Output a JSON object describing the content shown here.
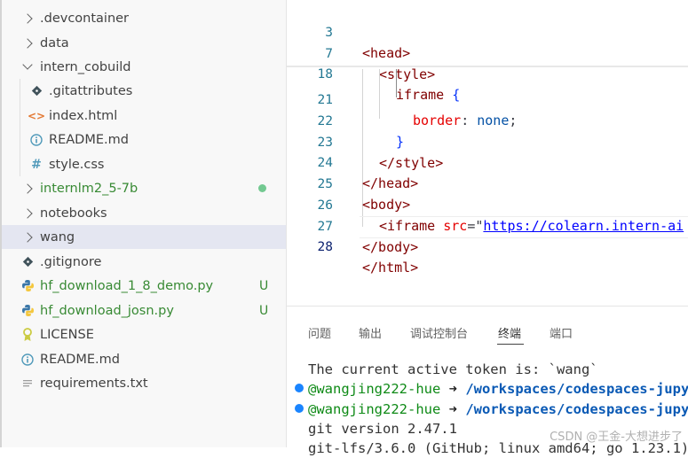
{
  "explorer": {
    "items": [
      {
        "label": ".devcontainer",
        "type": "folder-collapsed"
      },
      {
        "label": "data",
        "type": "folder-collapsed"
      },
      {
        "label": "intern_cobuild",
        "type": "folder-expanded"
      },
      {
        "label": ".gitattributes",
        "type": "git-icon"
      },
      {
        "label": "index.html",
        "type": "html-icon"
      },
      {
        "label": "README.md",
        "type": "info-icon"
      },
      {
        "label": "style.css",
        "type": "css-icon"
      },
      {
        "label": "internlm2_5-7b",
        "type": "folder-collapsed"
      },
      {
        "label": "notebooks",
        "type": "folder-collapsed"
      },
      {
        "label": "wang",
        "type": "folder-collapsed"
      },
      {
        "label": ".gitignore",
        "type": "git-icon"
      },
      {
        "label": "hf_download_1_8_demo.py",
        "type": "python-icon",
        "badge": "U"
      },
      {
        "label": "hf_download_josn.py",
        "type": "python-icon",
        "badge": "U"
      },
      {
        "label": "LICENSE",
        "type": "license-icon"
      },
      {
        "label": "README.md",
        "type": "info-icon"
      },
      {
        "label": "requirements.txt",
        "type": "text-icon"
      }
    ],
    "colors": {
      "selected_bg": "#e4e6f1",
      "untracked": "#388a34",
      "modified_dot": "#73c991"
    }
  },
  "editor": {
    "sticky": [
      {
        "ln": "3",
        "indent": "",
        "tag": "<head>"
      },
      {
        "ln": "7",
        "indent": "  ",
        "tag": "<style>"
      },
      {
        "ln": "18",
        "indent": "    ",
        "selector": "iframe",
        "brace": "{"
      }
    ],
    "lines": [
      {
        "ln": "21",
        "prop": "border",
        "colon": ":",
        "value": "none",
        "semi": ";"
      },
      {
        "ln": "22",
        "brace": "}"
      },
      {
        "ln": "23",
        "tag": "</style>"
      },
      {
        "ln": "24",
        "tag": "</head>"
      },
      {
        "ln": "25",
        "tag": "<body>"
      },
      {
        "ln": "26",
        "tag_open": "<iframe",
        "attr": "src",
        "eq": "=\"",
        "url": "https://colearn.intern-ai"
      },
      {
        "ln": "27",
        "tag": "</body>"
      },
      {
        "ln": "28",
        "tag": "</html>"
      }
    ]
  },
  "panel": {
    "tabs": [
      "问题",
      "输出",
      "调试控制台",
      "终端",
      "端口"
    ],
    "active_tab": "终端",
    "terminal": {
      "line1": "The current active token is: `wang`",
      "prompt_user": "@wangjing222-hue",
      "prompt_arrow": "➜",
      "prompt_path": "/workspaces/codespaces-jupyter",
      "git_version": "git version 2.47.1",
      "lfs_version": "git-lfs/3.6.0 (GitHub; linux amd64; go 1.23.1)"
    }
  },
  "watermark": "CSDN @王金-大想进步了"
}
